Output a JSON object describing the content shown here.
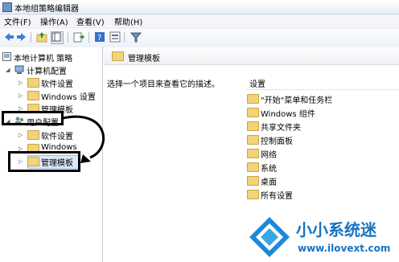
{
  "window": {
    "title": "本地组策略编辑器"
  },
  "menu": [
    "文件(F)",
    "操作(A)",
    "查看(V)",
    "帮助(H)"
  ],
  "toolbar_icons": [
    "back-icon",
    "forward-icon",
    "up-folder-icon",
    "show-tree-icon",
    "export-icon",
    "help-icon",
    "properties-icon",
    "filter-icon"
  ],
  "tree": {
    "root": "本地计算机 策略",
    "computer_config": "计算机配置",
    "cc_software": "软件设置",
    "cc_windows": "Windows 设置",
    "cc_admin": "管理模板",
    "user_config": "用户配置",
    "uc_software": "软件设置",
    "uc_windows": "Windows",
    "uc_admin": "管理模板"
  },
  "right": {
    "header_title": "管理模板",
    "description": "选择一个项目来查看它的描述。",
    "column_header": "设置",
    "items": [
      "\"开始\"菜单和任务栏",
      "Windows 组件",
      "共享文件夹",
      "控制面板",
      "网络",
      "系统",
      "桌面",
      "所有设置"
    ]
  },
  "watermark": {
    "brand": "小小系统迷",
    "url": "www.ilovext.com"
  },
  "colors": {
    "accent": "#1673c4",
    "folder": "#f2d27a",
    "selection": "#dbe8f7"
  }
}
